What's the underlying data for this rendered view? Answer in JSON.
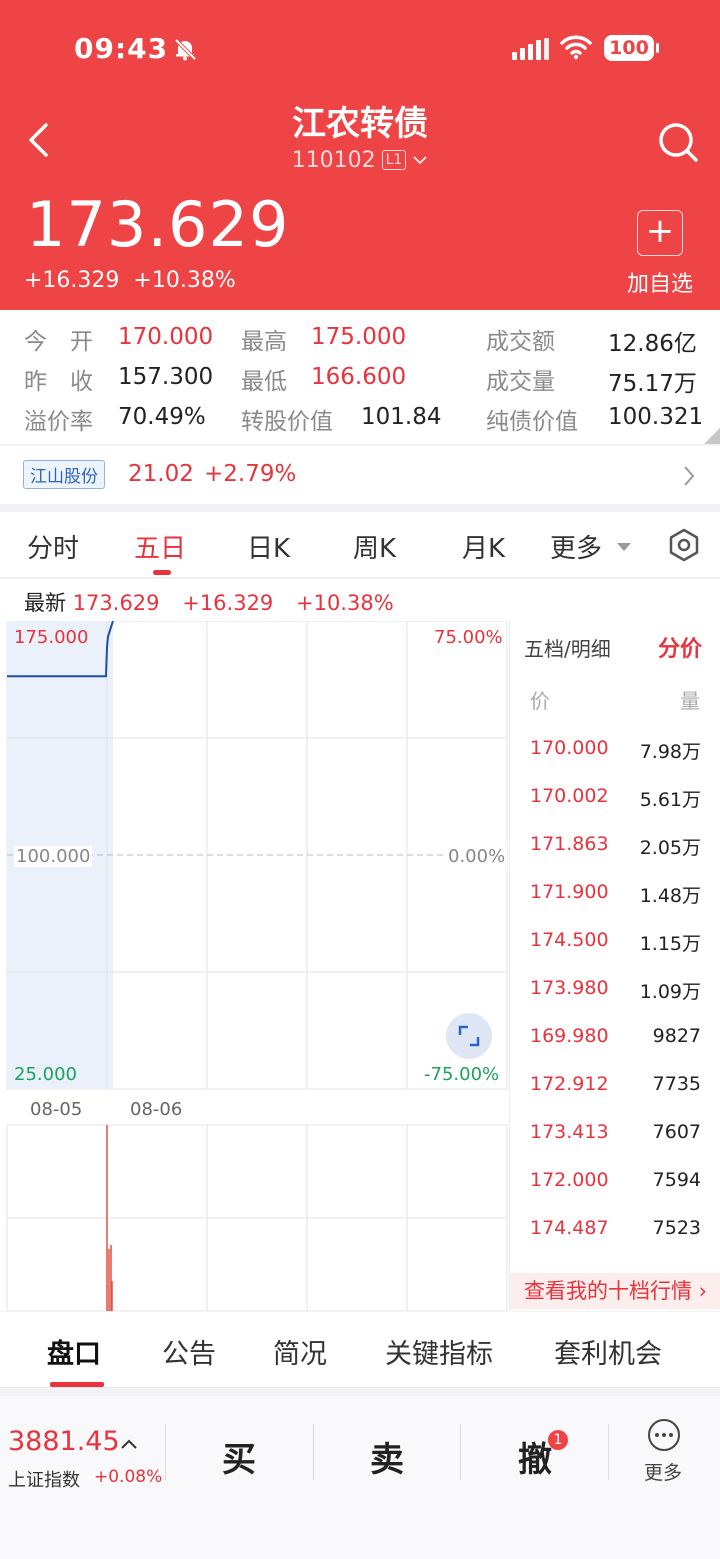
{
  "status_bar": {
    "time": "09:43",
    "battery": "100"
  },
  "header": {
    "title": "江农转债",
    "code": "110102",
    "level_tag": "L1",
    "price": "173.629",
    "change": "+16.329",
    "change_pct": "+10.38%",
    "add_watchlist": "加自选"
  },
  "stats": {
    "open_label": "今　开",
    "open": "170.000",
    "high_label": "最高",
    "high": "175.000",
    "turnover_label": "成交额",
    "turnover": "12.86亿",
    "prev_close_label": "昨　收",
    "prev_close": "157.300",
    "low_label": "最低",
    "low": "166.600",
    "volume_label": "成交量",
    "volume": "75.17万",
    "premium_label": "溢价率",
    "premium": "70.49%",
    "conv_value_label": "转股价值",
    "conv_value": "101.84",
    "bond_value_label": "纯债价值",
    "bond_value": "100.321"
  },
  "related": {
    "name": "江山股份",
    "price": "21.02",
    "change_pct": "+2.79%"
  },
  "chart_tabs": [
    "分时",
    "五日",
    "日K",
    "周K",
    "月K",
    "更多"
  ],
  "active_chart_tab": "五日",
  "latest": {
    "label": "最新",
    "price": "173.629",
    "change": "+16.329",
    "change_pct": "+10.38%"
  },
  "chart_data": {
    "type": "line",
    "y_left_ticks": [
      "175.000",
      "100.000",
      "25.000"
    ],
    "y_right_ticks": [
      "75.00%",
      "0.00%",
      "-75.00%"
    ],
    "ylim": [
      25,
      175
    ],
    "x_labels": [
      "08-05",
      "08-06"
    ],
    "series": [
      {
        "x": [
          0.0,
          0.98,
          0.99,
          1.0,
          1.01,
          1.04,
          1.06
        ],
        "y": [
          157.3,
          157.3,
          157.3,
          166.6,
          170.0,
          173.0,
          175.0
        ]
      }
    ]
  },
  "order_book": {
    "title": "五档/明细",
    "mode": "分价",
    "col_price": "价",
    "col_volume": "量",
    "rows": [
      {
        "p": "170.000",
        "v": "7.98万"
      },
      {
        "p": "170.002",
        "v": "5.61万"
      },
      {
        "p": "171.863",
        "v": "2.05万"
      },
      {
        "p": "171.900",
        "v": "1.48万"
      },
      {
        "p": "174.500",
        "v": "1.15万"
      },
      {
        "p": "173.980",
        "v": "1.09万"
      },
      {
        "p": "169.980",
        "v": "9827"
      },
      {
        "p": "172.912",
        "v": "7735"
      },
      {
        "p": "173.413",
        "v": "7607"
      },
      {
        "p": "172.000",
        "v": "7594"
      },
      {
        "p": "174.487",
        "v": "7523"
      }
    ],
    "more_link": "查看我的十档行情"
  },
  "sub_tabs": [
    "盘口",
    "公告",
    "简况",
    "关键指标",
    "套利机会"
  ],
  "bottom_bar": {
    "index_value": "3881.45",
    "index_name": "上证指数",
    "index_change": "+0.08%",
    "buy": "买",
    "sell": "卖",
    "cancel": "撤",
    "cancel_badge": "1",
    "more": "更多"
  }
}
